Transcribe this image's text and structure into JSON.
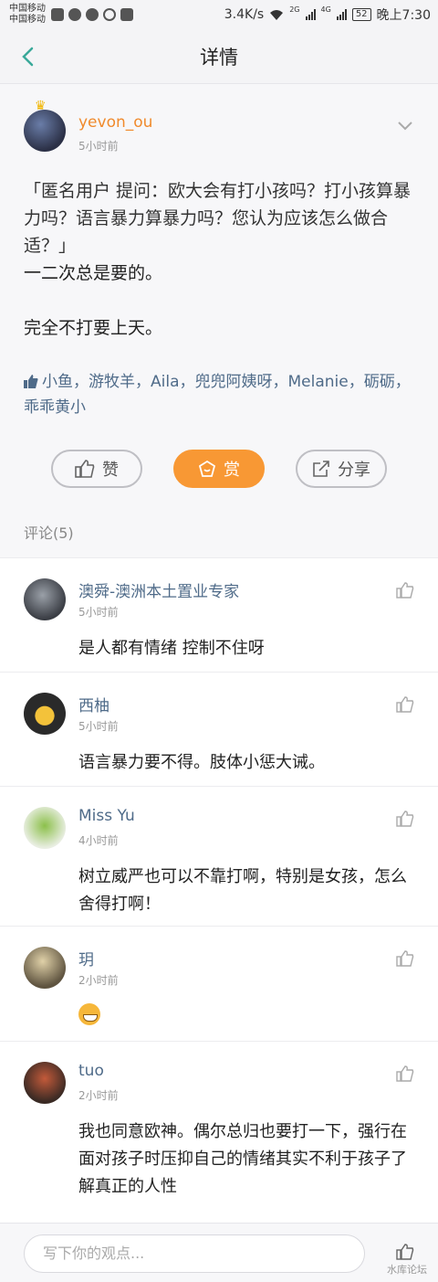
{
  "status_bar": {
    "carrier_1": "中国移动",
    "carrier_2": "中国移动",
    "speed": "3.4K/s",
    "net_1": "2G",
    "net_2": "4G",
    "battery": "52",
    "time": "晚上7:30"
  },
  "header": {
    "title": "详情"
  },
  "post": {
    "author": "yevon_ou",
    "time": "5小时前",
    "question": "「匿名用户  提问：欧大会有打小孩吗？打小孩算暴力吗？语言暴力算暴力吗？您认为应该怎么做合适？」",
    "body_1": "一二次总是要的。",
    "body_2": "完全不打要上天。",
    "likers": "小鱼，游牧羊，Aila，兜兜阿姨呀，Melanie，砺砺，乖乖黄小",
    "buttons": {
      "like": "赞",
      "reward": "赏",
      "share": "分享"
    }
  },
  "comments_title": "评论(5)",
  "comments": [
    {
      "name": "澳舜-澳洲本土置业专家",
      "time": "5小时前",
      "text": "是人都有情绪 控制不住呀"
    },
    {
      "name": "西柚",
      "time": "5小时前",
      "text": "语言暴力要不得。肢体小惩大诫。"
    },
    {
      "name": "Miss  Yu",
      "time": "4小时前",
      "text": "树立威严也可以不靠打啊，特别是女孩，怎么舍得打啊！"
    },
    {
      "name": "玥",
      "time": "2小时前",
      "text": ""
    },
    {
      "name": "tuo",
      "time": "2小时前",
      "text": "我也同意欧神。偶尔总归也要打一下，强行在面对孩子时压抑自己的情绪其实不利于孩子了解真正的人性"
    }
  ],
  "input": {
    "placeholder": "写下你的观点..."
  },
  "watermark": "水库论坛",
  "colors": {
    "accent": "#f89834",
    "link": "#4f6b89",
    "back": "#3aa99a"
  }
}
